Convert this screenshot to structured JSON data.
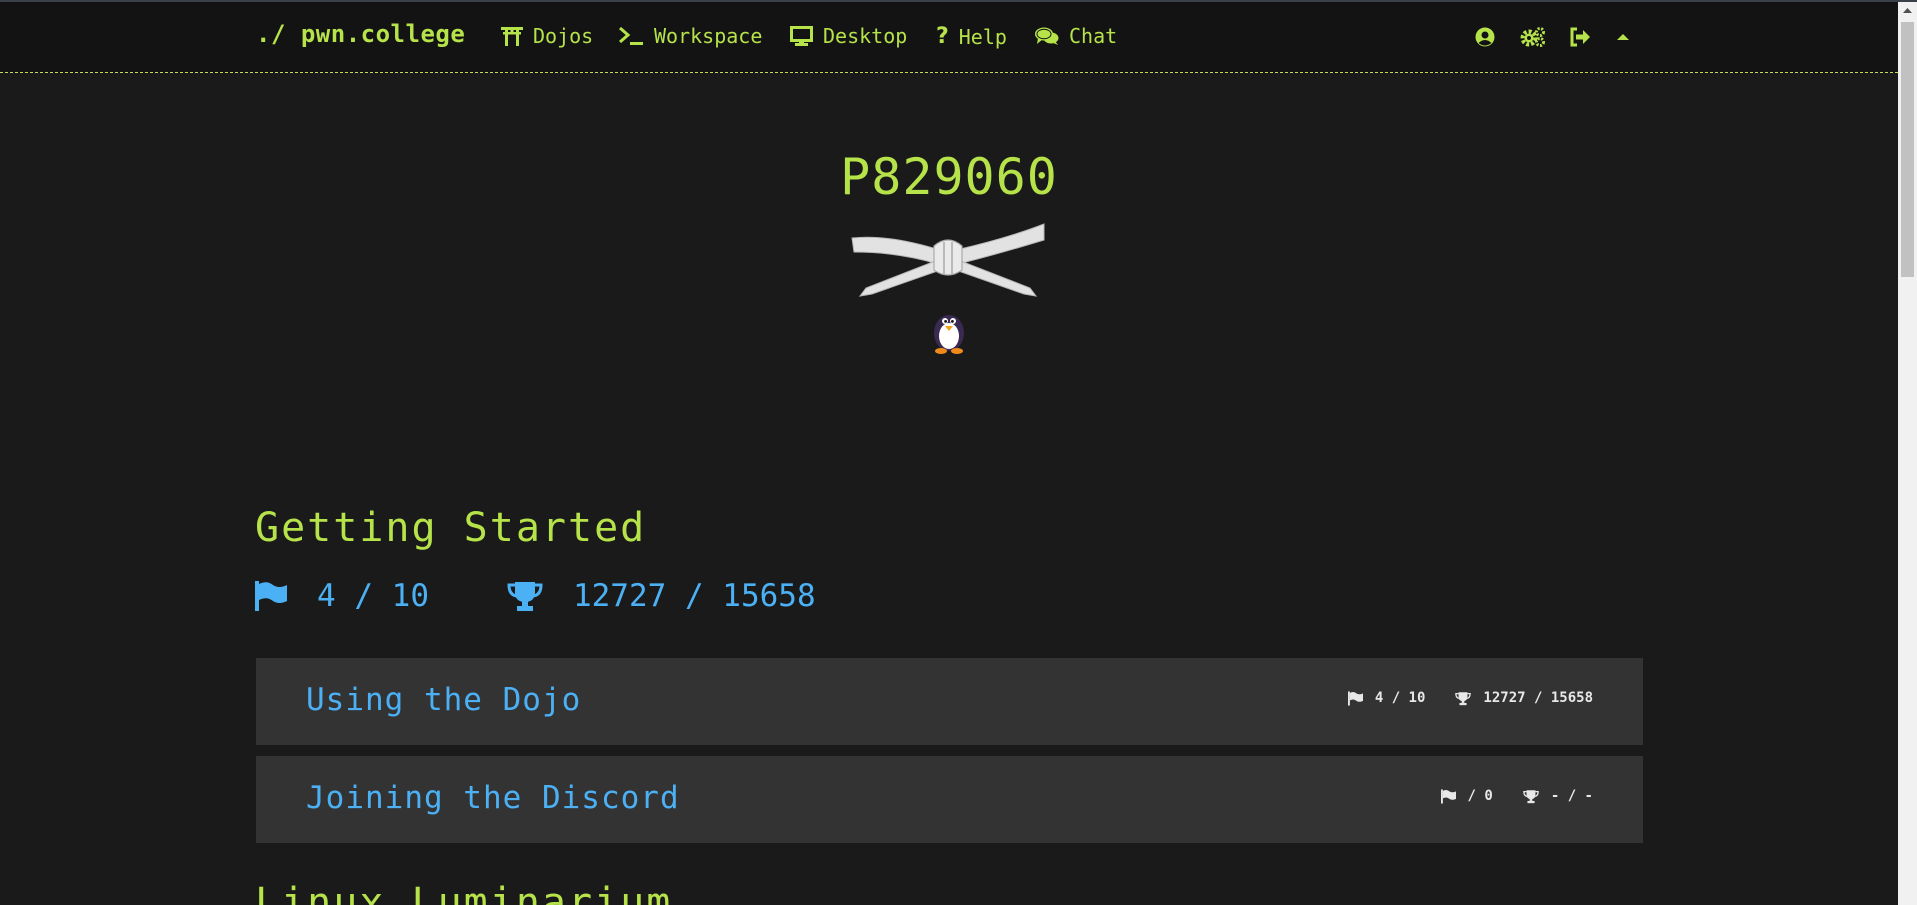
{
  "navbar": {
    "brand": "./ pwn.college",
    "items": [
      {
        "label": "Dojos",
        "icon": "torii-gate-icon"
      },
      {
        "label": "Workspace",
        "icon": "terminal-icon"
      },
      {
        "label": "Desktop",
        "icon": "desktop-icon"
      },
      {
        "label": "Help",
        "icon": "question-icon"
      },
      {
        "label": "Chat",
        "icon": "comments-icon"
      }
    ],
    "right_icons": [
      "user-circle-icon",
      "cogs-icon",
      "sign-out-icon",
      "caret-up-icon"
    ]
  },
  "profile": {
    "username": "P829060",
    "belt": "white belt",
    "avatar": "penguin"
  },
  "section": {
    "title": "Getting Started",
    "solved": "4 / 10",
    "points": "12727 / 15658"
  },
  "modules": [
    {
      "title": "Using the Dojo",
      "solved": "4 / 10",
      "points": "12727 / 15658"
    },
    {
      "title": "Joining the Discord",
      "solved": "/ 0",
      "points": "- / -"
    }
  ],
  "next_section": {
    "title": "Linux Luminarium"
  },
  "colors": {
    "background": "#1a1a1a",
    "navbar": "#131313",
    "accent_green": "#b6e24a",
    "accent_blue": "#4cb0f5",
    "card": "#333333"
  }
}
